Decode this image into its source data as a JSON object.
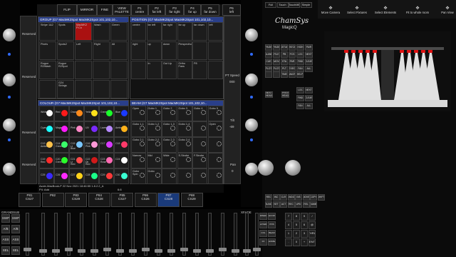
{
  "top_buttons": [
    "FLIP",
    "MIRROR",
    "FINE",
    "VIEW PALETTE"
  ],
  "playback_labels": [
    {
      "num": "P1",
      "name": "centre"
    },
    {
      "num": "P2",
      "name": "far left"
    },
    {
      "num": "P3",
      "name": "far right"
    },
    {
      "num": "P4",
      "name": "far up"
    },
    {
      "num": "P5",
      "name": "far down"
    },
    {
      "num": "P6",
      "name": "left"
    }
  ],
  "left_side_labels": [
    "Reserved",
    "Reserved",
    "Reserved",
    "Reserved"
  ],
  "right_side": {
    "pt_speed_label": "PT Speed",
    "pt_speed_value": "000",
    "tilt_label": "Tilt",
    "tilt_value": "-69",
    "pan_label": "Pan",
    "pan_value": "0"
  },
  "group_panel": {
    "title": "GROUP (G7 MacMK2Spot  MacMK2Spot 101,102,10...",
    "cells": [
      "Stripe 1&2",
      "Spots",
      "MacMK2 P.Cn",
      "Wash",
      "Green",
      "Pixels",
      "Spots2",
      "Left",
      "Right",
      "All",
      "Rogue R2Wash",
      "Rogue R2Spot",
      "",
      "",
      "",
      "",
      "G24 Strings",
      "",
      "",
      ""
    ]
  },
  "position_panel": {
    "title": "POSITION (G7 MacMK2Spot  MacMK2Spot 101,102,10...",
    "cells": [
      "centre",
      "far left",
      "far right",
      "far up",
      "far down",
      "left",
      "right",
      "up",
      "down",
      "Perspective",
      "",
      "",
      "",
      "In",
      "Out Up",
      "Ortho Fans",
      "P8",
      ""
    ]
  },
  "colour_panel": {
    "title": "COLOUR (G7 MacMK2Spot  MacMK2Spot 101,102,10...",
    "rows": [
      [
        {
          "n": "White",
          "c": "#ffffff"
        },
        {
          "n": "Red",
          "c": "#ff1a1a"
        },
        {
          "n": "Orange",
          "c": "#ff8a1a"
        },
        {
          "n": "Yellow",
          "c": "#ffe11a"
        },
        {
          "n": "Green",
          "c": "#1aff2a"
        },
        {
          "n": "Blue",
          "c": "#1a3aff"
        }
      ],
      [
        {
          "n": "Cyan",
          "c": "#1affff"
        },
        {
          "n": "Magenta",
          "c": "#ff1aff"
        },
        {
          "n": "Pink",
          "c": "#ff88c8"
        },
        {
          "n": "UV",
          "c": "#7a2aff"
        },
        {
          "n": "Lavender",
          "c": "#b78aff"
        },
        {
          "n": "Amber",
          "c": "#ffb21a"
        }
      ],
      [
        {
          "n": "C13 Amber",
          "c": "#ffc24a"
        },
        {
          "n": "C14 Green",
          "c": "#3aff6a"
        },
        {
          "n": "C15 Lt Blue",
          "c": "#7ac8ff"
        },
        {
          "n": "C16 Pink",
          "c": "#ff9ad8"
        },
        {
          "n": "C17",
          "c": "#d83aff"
        },
        {
          "n": "C18",
          "c": "#ff3a6a"
        }
      ],
      [
        {
          "n": "C19 Red",
          "c": "#ff2a2a"
        },
        {
          "n": "C20 Green",
          "c": "#2aff2a"
        },
        {
          "n": "C21 Lt Red",
          "c": "#ff4a4a"
        },
        {
          "n": "C22 Dk Red",
          "c": "#d21a1a"
        },
        {
          "n": "C23 Rose",
          "c": "#ff6ab2"
        },
        {
          "n": "C24",
          "c": "#ffffff"
        }
      ],
      [
        {
          "n": "C25",
          "c": "#3a2aff"
        },
        {
          "n": "C26",
          "c": "#ff2aff"
        },
        {
          "n": "C27",
          "c": "#ffd21a"
        },
        {
          "n": "C28",
          "c": "#1aff8a"
        },
        {
          "n": "C29",
          "c": "#ff3a3a"
        },
        {
          "n": "C30",
          "c": "#3affd2"
        }
      ]
    ]
  },
  "beam_panel": {
    "title": "BEAM (G7 MacMK2Spot  MacMK2Spot 101,102,10...",
    "cells": [
      "Open",
      "Gobo 1",
      "Gobo 2",
      "Gobo 3",
      "Gobo 4",
      "Gobo 5",
      "Gobo 1-1",
      "Gobo 1-2",
      "Gobo 1-3",
      "Gobo 1-4",
      "",
      "Open",
      "Gobo 2-1",
      "Gobo 2-2",
      "Gobo 2-3",
      "Gobo 2-4",
      "",
      "",
      "Narrow",
      "Mid",
      "Wide",
      "S.Strobe",
      "F.Strobe",
      "",
      "Gobo Spin",
      "Gobo",
      "",
      "",
      "",
      ""
    ]
  },
  "status": {
    "line1": "Azzie-MacBook-P 22 Nov 2021 18:46:55 1.8.2.2_A",
    "line2": "P4: Add",
    "page": "6:8"
  },
  "cue_row": [
    {
      "num": "P81",
      "name": "CS27"
    },
    {
      "num": "P82",
      "name": ""
    },
    {
      "num": "P83",
      "name": "CS29"
    },
    {
      "num": "P84",
      "name": "CS28"
    },
    {
      "num": "P85",
      "name": "CS27"
    },
    {
      "num": "P86",
      "name": "CS26"
    },
    {
      "num": "P87",
      "name": "CS28"
    },
    {
      "num": "P88",
      "name": "CS29"
    }
  ],
  "bottom_labels": {
    "grand": "GRAND",
    "sub": "SUB",
    "xfade": "XFADE"
  },
  "left_column_buttons": [
    "SWP",
    "A/B",
    "ASS",
    "SEL"
  ],
  "brand": {
    "name": "ChamSys",
    "product": "MagicQ"
  },
  "window_tabs": [
    "Full",
    "Touch",
    "TouchMB",
    "Simple"
  ],
  "viz_toolbar": [
    "Move Camera",
    "Select Fixtures",
    "Select Elements",
    "Fit to whole room",
    "Pan View"
  ],
  "keypad_top": [
    "PAGE",
    "PAGE",
    "SETUP",
    "PATCH",
    "BLANK",
    "FILE",
    "PB",
    "FCS",
    "CUE",
    "MOV",
    "STA",
    "PAR",
    "PLOT",
    "PLOT",
    "PLT",
    "EXEC"
  ],
  "keypad_side": [
    "HIGH",
    "PAIR",
    "LOC",
    "NEXT",
    "FIND",
    "CLEAR",
    "FAN",
    "ALL",
    "NEXT HEAD",
    "PREV HEAD"
  ],
  "numpad": [
    "7",
    "8",
    "9",
    "/",
    "4",
    "5",
    "6",
    "@",
    "1",
    "2",
    "3",
    "THRU",
    ".",
    "0",
    "+",
    "ENT"
  ],
  "lower_keys": [
    "REC",
    "INC",
    "CLR",
    "UNDO",
    "INS",
    "MOVE",
    "COPY",
    "SHIFT",
    "BLIND",
    "SET",
    "ACT",
    "REC",
    "UPD",
    "REL",
    "NAME"
  ],
  "cmd_keys": [
    "SPEED",
    "RECORD",
    "LAYER",
    "POS",
    "COL",
    "BEAM",
    "FX",
    "HOME"
  ]
}
